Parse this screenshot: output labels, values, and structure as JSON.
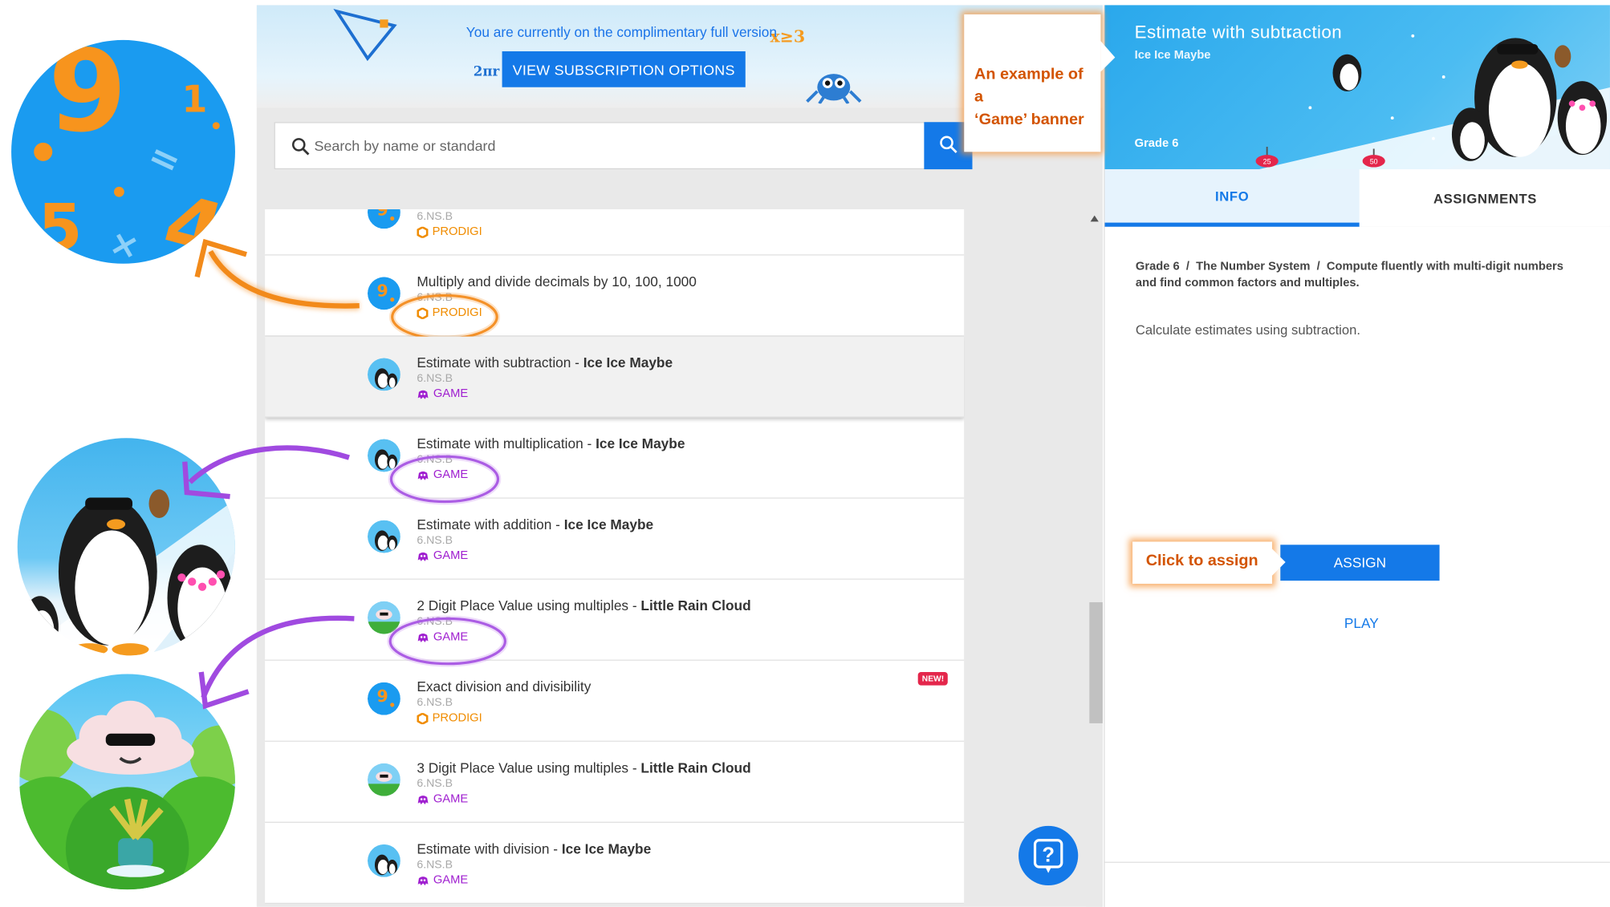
{
  "promo": {
    "text": "You are currently on the complimentary full version",
    "button": "VIEW SUBSCRIPTION OPTIONS",
    "deco_formula": "2πr",
    "deco_inequality": "x≥3"
  },
  "search": {
    "placeholder": "Search by name or standard"
  },
  "list": [
    {
      "title": "",
      "title_bold": "",
      "standard": "6.NS.B",
      "type": "PRODIGI",
      "icon": "prodigi-math-icon"
    },
    {
      "title": "Multiply and divide decimals by 10, 100, 1000",
      "title_bold": "",
      "standard": "6.NS.B",
      "type": "PRODIGI",
      "icon": "prodigi-math-icon"
    },
    {
      "title": "Estimate with subtraction - ",
      "title_bold": "Ice Ice Maybe",
      "standard": "6.NS.B",
      "type": "GAME",
      "icon": "penguin-icon"
    },
    {
      "title": "Estimate with multiplication - ",
      "title_bold": "Ice Ice Maybe",
      "standard": "6.NS.B",
      "type": "GAME",
      "icon": "penguin-icon"
    },
    {
      "title": "Estimate with addition - ",
      "title_bold": "Ice Ice Maybe",
      "standard": "6.NS.B",
      "type": "GAME",
      "icon": "penguin-icon"
    },
    {
      "title": "2 Digit Place Value using multiples - ",
      "title_bold": "Little Rain Cloud",
      "standard": "6.NS.B",
      "type": "GAME",
      "icon": "rain-cloud-icon"
    },
    {
      "title": "Exact division and divisibility",
      "title_bold": "",
      "standard": "6.NS.B",
      "type": "PRODIGI",
      "icon": "prodigi-math-icon",
      "badge": "NEW!"
    },
    {
      "title": "3 Digit Place Value using multiples - ",
      "title_bold": "Little Rain Cloud",
      "standard": "6.NS.B",
      "type": "GAME",
      "icon": "rain-cloud-icon"
    },
    {
      "title": "Estimate with division - ",
      "title_bold": "Ice Ice Maybe",
      "standard": "6.NS.B",
      "type": "GAME",
      "icon": "penguin-icon"
    }
  ],
  "detail": {
    "title": "Estimate with subtraction",
    "game_name": "Ice Ice Maybe",
    "grade": "Grade 6",
    "flag_25": "25",
    "flag_50": "50",
    "tabs": [
      "INFO",
      "ASSIGNMENTS"
    ],
    "breadcrumb_1": "Grade 6",
    "breadcrumb_2": "The Number System",
    "breadcrumb_3": "Compute fluently with multi-digit numbers and find common factors and multiples.",
    "description": "Calculate estimates using subtraction.",
    "assign_label": "ASSIGN",
    "play_label": "PLAY"
  },
  "annotations": {
    "game_banner_line1": "An example of a",
    "game_banner_line2": "‘Game’ banner",
    "click_to_assign": "Click to assign"
  },
  "illustrations": {
    "prodigi_digits": [
      "9",
      "1",
      "=",
      "5",
      "×",
      "4"
    ]
  },
  "colors": {
    "primary_blue": "#1479e8",
    "prodigi_orange": "#f08c00",
    "game_purple": "#a020d0",
    "callout_orange": "#d35400",
    "new_badge_red": "#e4264b"
  }
}
